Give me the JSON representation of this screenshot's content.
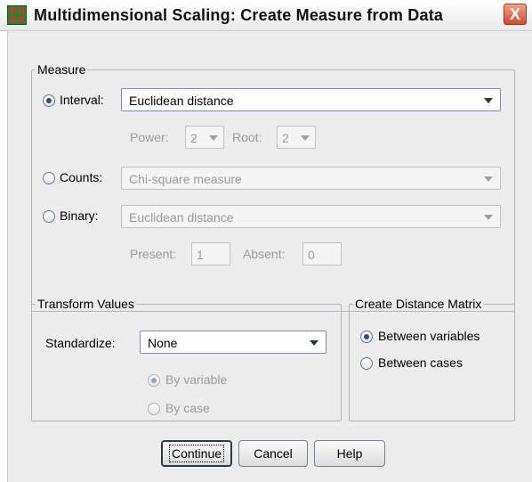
{
  "window": {
    "title": "Multidimensional Scaling: Create Measure from Data",
    "close_label": "X"
  },
  "measure": {
    "legend": "Measure",
    "interval_label": "Interval:",
    "interval_value": "Euclidean distance",
    "power_label": "Power:",
    "power_value": "2",
    "root_label": "Root:",
    "root_value": "2",
    "counts_label": "Counts:",
    "counts_value": "Chi-square measure",
    "binary_label": "Binary:",
    "binary_value": "Euclidean distance",
    "present_label": "Present:",
    "present_value": "1",
    "absent_label": "Absent:",
    "absent_value": "0",
    "selected": "Interval"
  },
  "transform": {
    "legend": "Transform Values",
    "standardize_label": "Standardize:",
    "standardize_value": "None",
    "by_variable_label": "By variable",
    "by_case_label": "By case"
  },
  "matrix": {
    "legend": "Create Distance Matrix",
    "between_variables_label": "Between variables",
    "between_cases_label": "Between cases",
    "selected": "Between variables"
  },
  "buttons": {
    "continue_label": "Continue",
    "cancel_label": "Cancel",
    "help_label": "Help"
  }
}
